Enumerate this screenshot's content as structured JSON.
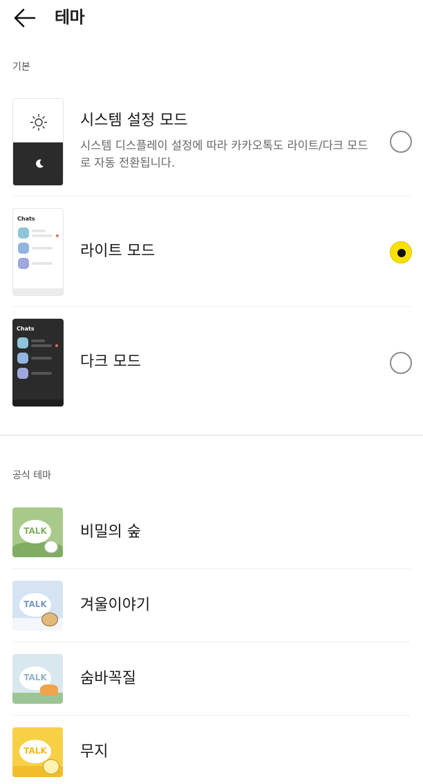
{
  "header": {
    "title": "테마"
  },
  "basic": {
    "section_label": "기본",
    "system": {
      "title": "시스템 설정 모드",
      "description": "시스템 디스플레이 설정에 따라 카카오톡도 라이트/다크 모드로 자동 전환됩니다.",
      "selected": false
    },
    "light": {
      "title": "라이트 모드",
      "preview_label": "Chats",
      "selected": true
    },
    "dark": {
      "title": "다크 모드",
      "preview_label": "Chats",
      "selected": false
    }
  },
  "official": {
    "section_label": "공식 테마",
    "badge_text": "TALK",
    "items": [
      {
        "title": "비밀의 숲"
      },
      {
        "title": "겨울이야기"
      },
      {
        "title": "숨바꼭질"
      },
      {
        "title": "무지"
      }
    ]
  },
  "colors": {
    "accent": "#FAE100",
    "radio_off": "#8A8A8A",
    "dark_bg": "#2B2B2B"
  },
  "icons": [
    "back-arrow-icon",
    "sun-icon",
    "moon-icon",
    "radio-button-icon"
  ]
}
